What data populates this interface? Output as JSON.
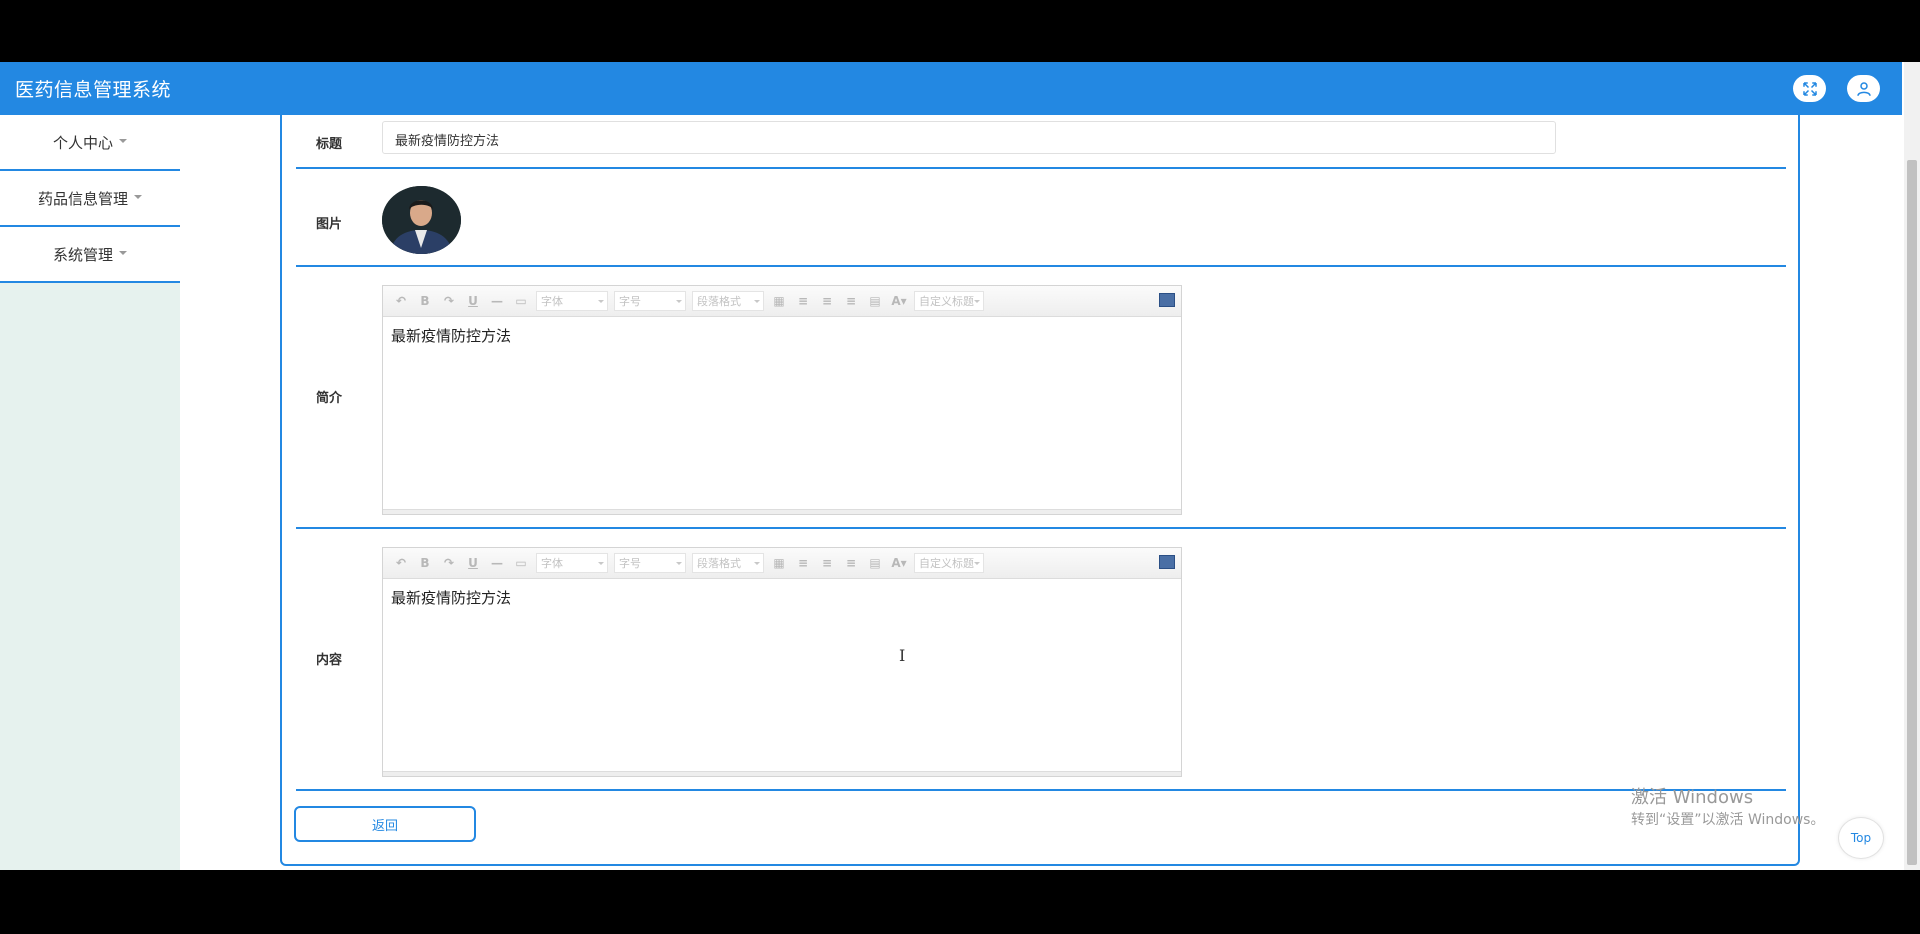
{
  "header": {
    "title": "医药信息管理系统",
    "bg_color": "#2388e2"
  },
  "icons": {
    "fullscreen": "fullscreen-icon",
    "user": "user-icon"
  },
  "sidebar": {
    "items": [
      {
        "label": "个人中心"
      },
      {
        "label": "药品信息管理"
      },
      {
        "label": "系统管理"
      }
    ]
  },
  "form": {
    "title_label": "标题",
    "title_value": "最新疫情防控方法",
    "image_label": "图片",
    "intro_label": "简介",
    "intro_value": "最新疫情防控方法",
    "content_label": "内容",
    "content_value": "最新疫情防控方法"
  },
  "editor_toolbar": {
    "font": "字体",
    "size": "字号",
    "paragraph": "段落格式",
    "custom_title": "自定义标题"
  },
  "back_button": "返回",
  "watermark": {
    "line1": "激活 Windows",
    "line2": "转到“设置”以激活 Windows。"
  },
  "top_button": "Top"
}
